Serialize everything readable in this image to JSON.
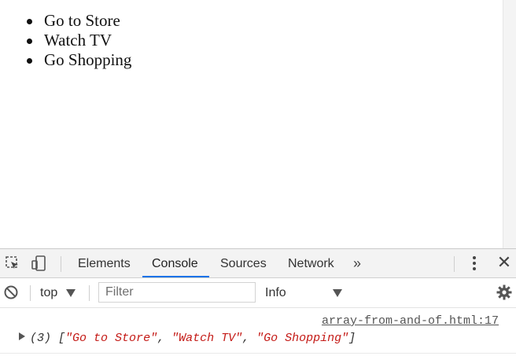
{
  "page": {
    "list_items": [
      "Go to Store",
      "Watch TV",
      "Go Shopping"
    ]
  },
  "devtools": {
    "tabs": [
      {
        "label": "Elements",
        "active": false
      },
      {
        "label": "Console",
        "active": true
      },
      {
        "label": "Sources",
        "active": false
      },
      {
        "label": "Network",
        "active": false
      }
    ],
    "overflow_label": "»",
    "close_label": "✕",
    "filterbar": {
      "context": "top",
      "filter_placeholder": "Filter",
      "level": "Info"
    },
    "console": {
      "source_link": "array-from-and-of.html:17",
      "log": {
        "count": "(3)",
        "open": "[",
        "items": [
          "\"Go to Store\"",
          "\"Watch TV\"",
          "\"Go Shopping\""
        ],
        "sep": ", ",
        "close": "]"
      }
    },
    "colors": {
      "accent": "#1a73e8",
      "string": "#c41a16"
    },
    "icons": [
      "inspect-element-icon",
      "device-toolbar-icon",
      "clear-console-icon",
      "settings-gear-icon",
      "kebab-menu-icon",
      "close-icon"
    ]
  }
}
